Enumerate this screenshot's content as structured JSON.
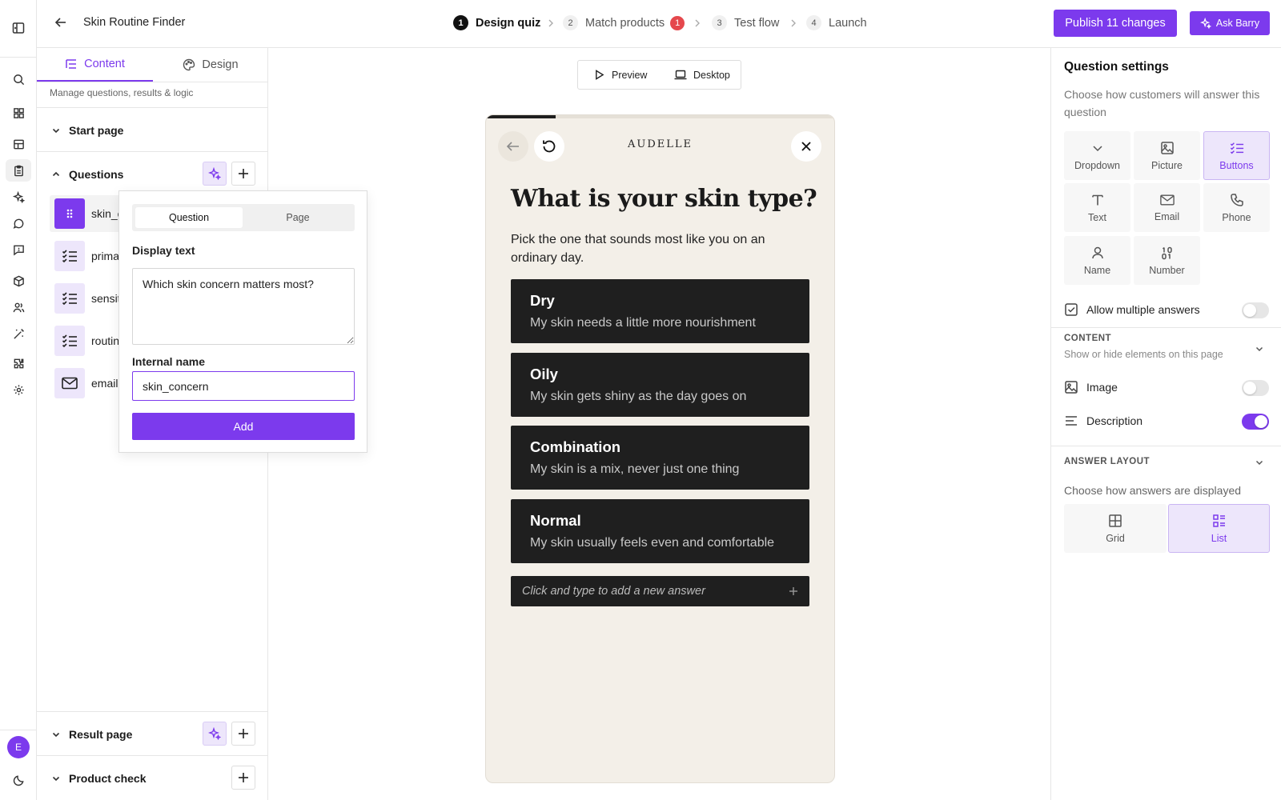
{
  "app": {
    "title": "Skin Routine Finder"
  },
  "steps": [
    {
      "num": "1",
      "label": "Design quiz"
    },
    {
      "num": "2",
      "label": "Match products",
      "badge": "1"
    },
    {
      "num": "3",
      "label": "Test flow"
    },
    {
      "num": "4",
      "label": "Launch"
    }
  ],
  "topbar": {
    "publish_label": "Publish 11 changes",
    "ask_label": "Ask Barry"
  },
  "left": {
    "tabs": [
      {
        "label": "Content"
      },
      {
        "label": "Design"
      }
    ],
    "subtitle": "Manage questions, results & logic",
    "sections": {
      "start": "Start page",
      "questions": "Questions",
      "result": "Result page",
      "product_check": "Product check"
    },
    "questions": [
      {
        "label": "skin_concern",
        "icon": "drag-handle-icon"
      },
      {
        "label": "primary_goal",
        "icon": "checklist-icon"
      },
      {
        "label": "sensitivity",
        "icon": "checklist-icon"
      },
      {
        "label": "routine_length",
        "icon": "checklist-icon"
      },
      {
        "label": "email",
        "icon": "mail-icon"
      }
    ],
    "user_initial": "E"
  },
  "popover": {
    "tabs": [
      {
        "label": "Question"
      },
      {
        "label": "Page"
      }
    ],
    "display_label": "Display text",
    "display_value": "Which skin concern matters most?",
    "internal_label": "Internal name",
    "internal_value": "skin_concern",
    "add_label": "Add"
  },
  "preview": {
    "preview_label": "Preview",
    "device_label": "Desktop",
    "brand": "AUDELLE",
    "question": "What is your skin type?",
    "description": "Pick the one that sounds most like you on an ordinary day.",
    "progress": 0.2,
    "answers": [
      {
        "title": "Dry",
        "desc": "My skin needs a little more nourishment"
      },
      {
        "title": "Oily",
        "desc": "My skin gets shiny as the day goes on"
      },
      {
        "title": "Combination",
        "desc": "My skin is a mix, never just one thing"
      },
      {
        "title": "Normal",
        "desc": "My skin usually feels even and comfortable"
      }
    ],
    "add_answer": "Click and type to add a new answer"
  },
  "settings": {
    "title": "Question settings",
    "subtitle": "Choose how customers will answer this question",
    "types": [
      {
        "label": "Dropdown",
        "icon": "chevron-down-icon"
      },
      {
        "label": "Picture",
        "icon": "image-icon"
      },
      {
        "label": "Buttons",
        "icon": "checklist-icon",
        "selected": true
      },
      {
        "label": "Text",
        "icon": "text-icon"
      },
      {
        "label": "Email",
        "icon": "mail-icon"
      },
      {
        "label": "Phone",
        "icon": "phone-icon"
      },
      {
        "label": "Name",
        "icon": "person-icon"
      },
      {
        "label": "Number",
        "icon": "number-icon"
      }
    ],
    "allow_multiple": {
      "label": "Allow multiple answers",
      "on": false
    },
    "content_header": "CONTENT",
    "content_sub": "Show or hide elements on this page",
    "image": {
      "label": "Image",
      "on": false
    },
    "description": {
      "label": "Description",
      "on": true
    },
    "layout_header": "ANSWER LAYOUT",
    "layout_sub": "Choose how answers are displayed",
    "layouts": [
      {
        "label": "Grid",
        "selected": false
      },
      {
        "label": "List",
        "selected": true
      }
    ]
  },
  "colors": {
    "accent": "#7c3aed",
    "accent_soft": "#ede6fb",
    "badge": "#e5484d",
    "phone_bg": "#f3efe8",
    "answer_bg": "#1f1f1f"
  }
}
